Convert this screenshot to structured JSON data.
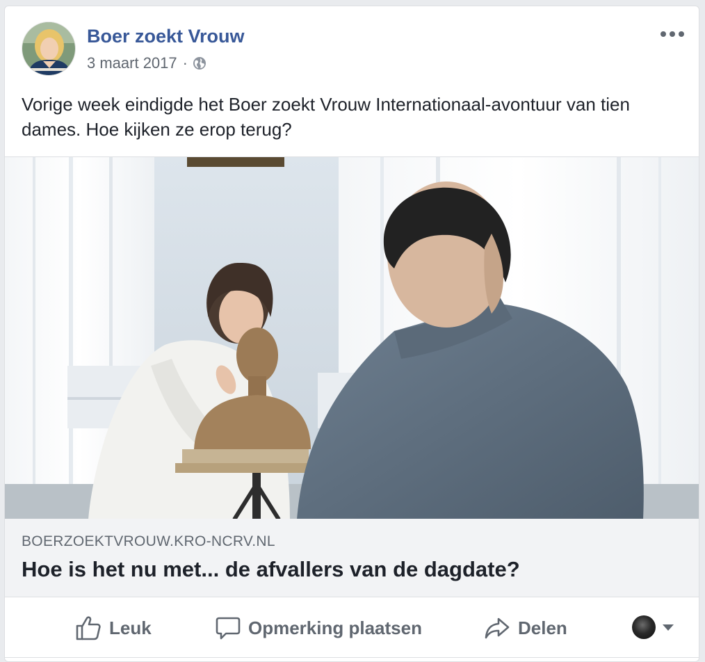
{
  "post": {
    "page_name": "Boer zoekt Vrouw",
    "date": "3 maart 2017",
    "separator": "·",
    "privacy_icon": "globe-icon",
    "more_icon": "more-options-icon",
    "text": "Vorige week eindigde het Boer zoekt Vrouw Internationaal-avontuur van tien dames. Hoe kijken ze erop terug?"
  },
  "link": {
    "domain": "BOERZOEKTVROUW.KRO-NCRV.NL",
    "title": "Hoe is het nu met... de afvallers van de dagdate?"
  },
  "actions": {
    "like_label": "Leuk",
    "like_icon": "thumbs-up-icon",
    "comment_label": "Opmerking plaatsen",
    "comment_icon": "speech-bubble-icon",
    "share_label": "Delen",
    "share_icon": "share-arrow-icon",
    "audience_icon": "chevron-down-icon"
  },
  "colors": {
    "page_name": "#385898",
    "secondary_text": "#606770",
    "body_text": "#1d2129",
    "link_box_bg": "#f2f3f5",
    "border": "#dddfe2"
  }
}
